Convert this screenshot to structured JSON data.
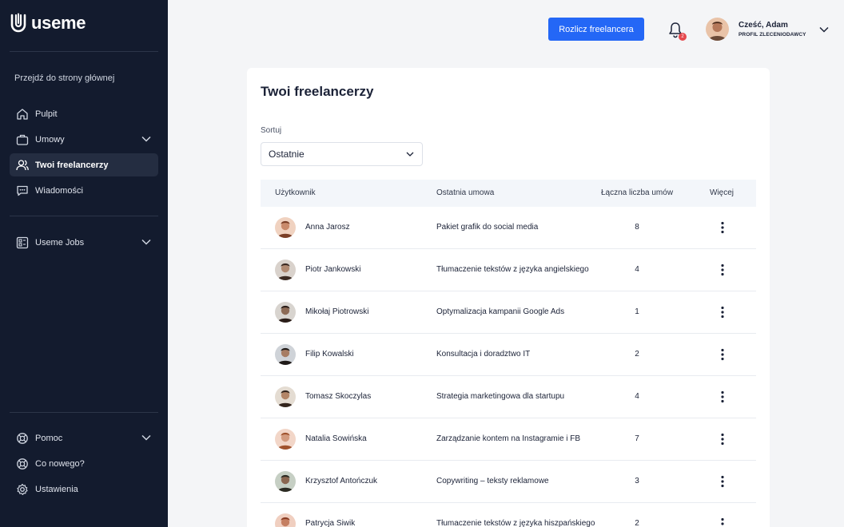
{
  "app": {
    "brand": "useme"
  },
  "sidebar": {
    "home_link": "Przejdź do strony głównej",
    "items": [
      {
        "label": "Pulpit",
        "icon": "home-icon"
      },
      {
        "label": "Umowy",
        "icon": "briefcase-icon"
      },
      {
        "label": "Twoi freelancerzy",
        "icon": "users-icon"
      },
      {
        "label": "Wiadomości",
        "icon": "message-icon"
      },
      {
        "label": "Useme Jobs",
        "icon": "jobs-icon"
      }
    ],
    "bottom_items": [
      {
        "label": "Pomoc",
        "icon": "lifebuoy-icon"
      },
      {
        "label": "Co nowego?",
        "icon": "whats-new-icon"
      },
      {
        "label": "Ustawienia",
        "icon": "gear-icon"
      }
    ]
  },
  "topbar": {
    "settle_button": "Rozlicz freelancera",
    "notifications_count": "2",
    "greeting": "Cześć, Adam",
    "role": "PROFIL ZLECENIODAWCY"
  },
  "main": {
    "title": "Twoi freelancerzy",
    "sort_label": "Sortuj",
    "sort_value": "Ostatnie",
    "columns": [
      "Użytkownik",
      "Ostatnia umowa",
      "Łączna liczba umów",
      "Więcej"
    ],
    "rows": [
      {
        "name": "Anna Jarosz",
        "contract": "Pakiet grafik do social media",
        "count": "8"
      },
      {
        "name": "Piotr Jankowski",
        "contract": "Tłumaczenie tekstów z języka angielskiego",
        "count": "4"
      },
      {
        "name": "Mikołaj Piotrowski",
        "contract": "Optymalizacja kampanii Google Ads",
        "count": "1"
      },
      {
        "name": "Filip Kowalski",
        "contract": "Konsultacja i doradztwo IT",
        "count": "2"
      },
      {
        "name": "Tomasz Skoczylas",
        "contract": "Strategia marketingowa dla startupu",
        "count": "4"
      },
      {
        "name": "Natalia Sowińska",
        "contract": "Zarządzanie kontem na Instagramie i FB",
        "count": "7"
      },
      {
        "name": "Krzysztof Antończuk",
        "contract": "Copywriting – teksty reklamowe",
        "count": "3"
      },
      {
        "name": "Patrycja Siwik",
        "contract": "Tłumaczenie tekstów z języka hiszpańskiego",
        "count": "2"
      }
    ]
  },
  "colors": {
    "sidebar_bg": "#131b2e",
    "accent": "#2467f6",
    "badge": "#e5484d"
  }
}
